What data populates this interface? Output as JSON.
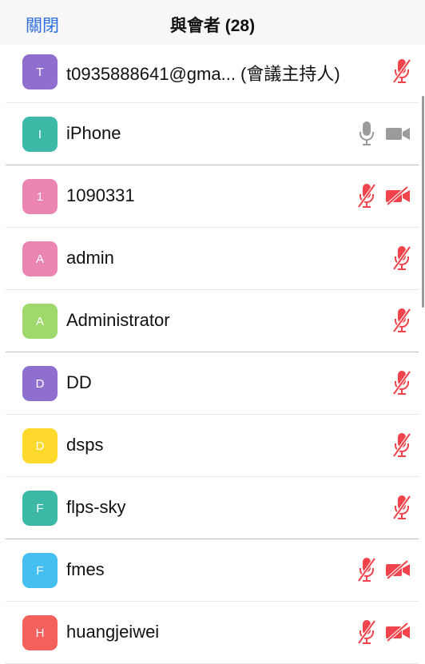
{
  "header": {
    "close_label": "關閉",
    "title": "與會者 (28)"
  },
  "colors": {
    "accent": "#2f6fe0",
    "muted_red": "#f0434b",
    "inactive_gray": "#9b9b9b"
  },
  "participants": [
    {
      "initial": "T",
      "name": "t0935888641@gma... (會議主持人)",
      "avatar_color": "#8e6fd0",
      "mic": "mic-muted-icon",
      "video": null
    },
    {
      "initial": "I",
      "name": "iPhone",
      "avatar_color": "#3cb9a7",
      "mic": "mic-icon",
      "video": "video-icon"
    },
    {
      "initial": "1",
      "name": "1090331",
      "avatar_color": "#eb86b3",
      "mic": "mic-muted-icon",
      "video": "video-off-icon"
    },
    {
      "initial": "A",
      "name": "admin",
      "avatar_color": "#eb86b3",
      "mic": "mic-muted-icon",
      "video": null
    },
    {
      "initial": "A",
      "name": "Administrator",
      "avatar_color": "#9fd86b",
      "mic": "mic-muted-icon",
      "video": null
    },
    {
      "initial": "D",
      "name": "DD",
      "avatar_color": "#8e6fd0",
      "mic": "mic-muted-icon",
      "video": null
    },
    {
      "initial": "D",
      "name": "dsps",
      "avatar_color": "#ffd92b",
      "mic": "mic-muted-icon",
      "video": null
    },
    {
      "initial": "F",
      "name": "flps-sky",
      "avatar_color": "#3cb9a7",
      "mic": "mic-muted-icon",
      "video": null
    },
    {
      "initial": "F",
      "name": "fmes",
      "avatar_color": "#45bff0",
      "mic": "mic-muted-icon",
      "video": "video-off-icon"
    },
    {
      "initial": "H",
      "name": "huangjeiwei",
      "avatar_color": "#f4605c",
      "mic": "mic-muted-icon",
      "video": "video-off-icon"
    }
  ]
}
